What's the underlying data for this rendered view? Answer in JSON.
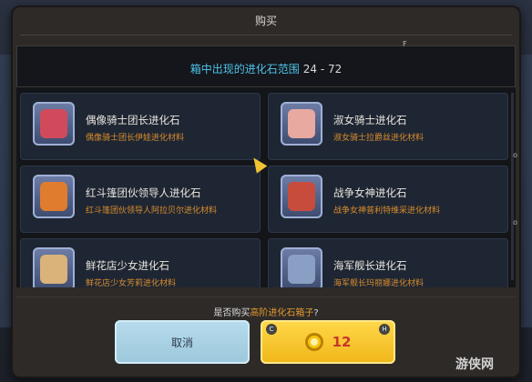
{
  "dialog": {
    "title": "购买",
    "range_label": "箱中出现的进化石范围",
    "range_value": "24 - 72",
    "corner_marker": "F"
  },
  "items": [
    {
      "name": "偶像骑士团长进化石",
      "desc": "偶像骑士团长伊娃进化材料",
      "face_color": "#d04a5b"
    },
    {
      "name": "淑女骑士进化石",
      "desc": "淑女骑士拉爵丝进化材料",
      "face_color": "#e7a9a0"
    },
    {
      "name": "红斗篷团伙领导人进化石",
      "desc": "红斗篷团伙领导人阿拉贝尔进化材料",
      "face_color": "#e07c2e"
    },
    {
      "name": "战争女神进化石",
      "desc": "战争女神普利特维采进化材料",
      "face_color": "#c74c3c"
    },
    {
      "name": "鲜花店少女进化石",
      "desc": "鲜花店少女芳莉进化材料",
      "face_color": "#d9b37a"
    },
    {
      "name": "海军舰长进化石",
      "desc": "海军舰长玛丽娜进化材料",
      "face_color": "#8a9fc4"
    }
  ],
  "scroll_marks": [
    "o",
    "o"
  ],
  "question": {
    "prefix": "是否购买",
    "highlight": "高阶进化石箱子",
    "suffix": "?"
  },
  "buttons": {
    "cancel_label": "取消",
    "price": "12",
    "key_left": "C",
    "key_right": "H"
  },
  "watermark": "游侠网"
}
